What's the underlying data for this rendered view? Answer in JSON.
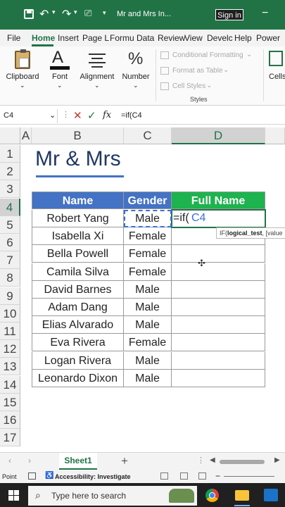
{
  "titlebar": {
    "filename": "Mr and Mrs In...",
    "signin": "Sign in"
  },
  "tabs": [
    "File",
    "Home",
    "Insert",
    "Page L",
    "Formu",
    "Data",
    "Review",
    "View",
    "Develc",
    "Help",
    "Power"
  ],
  "ribbon": {
    "clipboard": "Clipboard",
    "font": "Font",
    "alignment": "Alignment",
    "number": "Number",
    "conditional_formatting": "Conditional Formatting",
    "format_as_table": "Format as Table",
    "cell_styles": "Cell Styles",
    "styles_group": "Styles",
    "cells": "Cells"
  },
  "formula_bar": {
    "name_box": "C4",
    "fx": "fx",
    "formula": "=if(C4"
  },
  "columns": [
    "A",
    "B",
    "C",
    "D"
  ],
  "rows": [
    "1",
    "2",
    "3",
    "4",
    "5",
    "6",
    "7",
    "8",
    "9",
    "10",
    "11",
    "12",
    "13",
    "14",
    "15",
    "16",
    "17"
  ],
  "sheet_title": "Mr & Mrs",
  "table": {
    "headers": [
      "Name",
      "Gender",
      "Full Name"
    ],
    "rows": [
      [
        "Robert Yang",
        "Male"
      ],
      [
        "Isabella Xi",
        "Female"
      ],
      [
        "Bella Powell",
        "Female"
      ],
      [
        "Camila Silva",
        "Female"
      ],
      [
        "David Barnes",
        "Male"
      ],
      [
        "Adam Dang",
        "Male"
      ],
      [
        "Elias Alvarado",
        "Male"
      ],
      [
        "Eva Rivera",
        "Female"
      ],
      [
        "Logan Rivera",
        "Male"
      ],
      [
        "Leonardo Dixon",
        "Male"
      ]
    ]
  },
  "editing": {
    "prefix": "=if(",
    "ref": "C4"
  },
  "tooltip": {
    "fn": "IF(",
    "arg": "logical_test",
    "rest": ", [value"
  },
  "sheet_tab": "Sheet1",
  "status": {
    "mode": "Point",
    "accessibility": "Accessibility: Investigate"
  },
  "taskbar": {
    "search_placeholder": "Type here to search"
  },
  "colors": {
    "excel_green": "#217346",
    "header_blue": "#4472c4",
    "header_green": "#1db34e",
    "ref_blue": "#3a6fd8"
  }
}
